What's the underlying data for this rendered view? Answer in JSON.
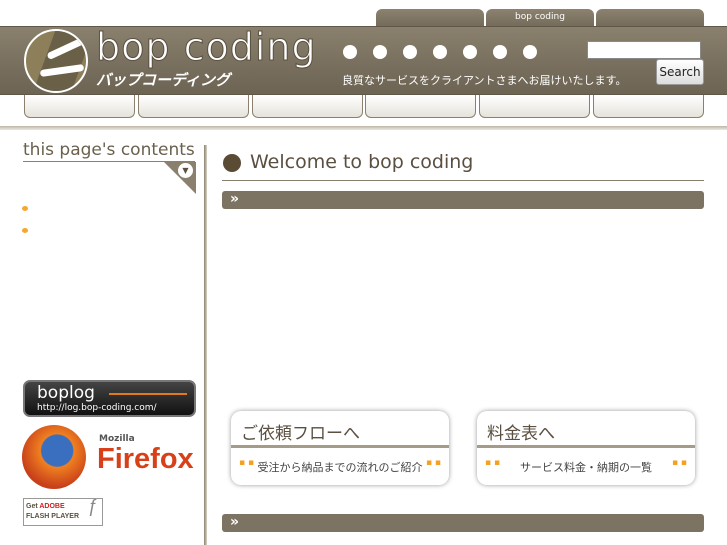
{
  "top_tabs": [
    "",
    "bop coding",
    ""
  ],
  "header": {
    "title": "bop coding",
    "subtitle_kana": "バップコーディング",
    "tagline": "良質なサービスをクライアントさまへお届けいたします。",
    "search_placeholder": "",
    "search_button": "Search"
  },
  "nav_buttons": [
    "",
    "",
    "",
    "",
    "",
    ""
  ],
  "sidebar": {
    "title": "this page's contents",
    "boplog": {
      "name": "boplog",
      "url": "http://log.bop-coding.com/"
    },
    "firefox": {
      "brand": "Mozilla",
      "name": "Firefox"
    },
    "flash": {
      "line1": "Get",
      "line1b": "ADOBE",
      "line2": "FLASH PLAYER"
    }
  },
  "main": {
    "heading": "Welcome to bop coding",
    "bar_icon": "»",
    "cards": [
      {
        "title": "ご依頼フローへ",
        "subtitle": "受注から納品までの流れのご紹介"
      },
      {
        "title": "料金表へ",
        "subtitle": "サービス料金・納期の一覧"
      }
    ]
  }
}
